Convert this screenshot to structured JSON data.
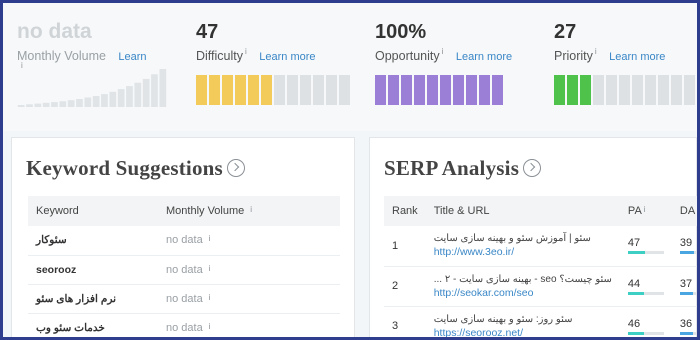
{
  "metrics": {
    "monthly_volume": {
      "value": "no data",
      "label": "Monthly Volume",
      "learn": "Learn",
      "info": "i"
    },
    "difficulty": {
      "value": "47",
      "label": "Difficulty",
      "learn": "Learn more",
      "info": "i",
      "color": "#f2cb5b",
      "filled": 6,
      "total": 12
    },
    "opportunity": {
      "value": "100%",
      "label": "Opportunity",
      "learn": "Learn more",
      "info": "i",
      "color": "#9b7fd6",
      "filled": 10,
      "total": 10
    },
    "priority": {
      "value": "27",
      "label": "Priority",
      "learn": "Learn more",
      "info": "i",
      "color": "#4ec24b",
      "filled": 3,
      "total": 11
    }
  },
  "volume_chart": {
    "levels": [
      0.05,
      0.07,
      0.09,
      0.11,
      0.13,
      0.15,
      0.18,
      0.21,
      0.25,
      0.29,
      0.34,
      0.4,
      0.47,
      0.55,
      0.64,
      0.74,
      0.86,
      1.0
    ]
  },
  "keyword_suggestions": {
    "title": "Keyword Suggestions",
    "headers": [
      "Keyword",
      "Monthly Volume"
    ],
    "header_info": "i",
    "rows": [
      {
        "keyword": "سئوکار",
        "volume": "no data",
        "info": "i"
      },
      {
        "keyword": "seorooz",
        "volume": "no data",
        "info": "i"
      },
      {
        "keyword": "نرم افزار های سئو",
        "volume": "no data",
        "info": "i"
      },
      {
        "keyword": "خدمات سئو وب",
        "volume": "no data",
        "info": "i"
      }
    ]
  },
  "serp_analysis": {
    "title": "SERP Analysis",
    "headers": [
      "Rank",
      "Title & URL",
      "PA",
      "DA"
    ],
    "header_info": "i",
    "rows": [
      {
        "rank": "1",
        "title": "سئو | آموزش سئو و بهینه سازی سایت",
        "url": "http://www.3eo.ir/",
        "pa": "47",
        "da": "39",
        "pa_pct": 0.47,
        "da_pct": 0.39
      },
      {
        "rank": "2",
        "title": "سئو چیست؟ seo - بهینه سازی سایت - ۲ ...",
        "url": "http://seokar.com/seo",
        "pa": "44",
        "da": "37",
        "pa_pct": 0.44,
        "da_pct": 0.37
      },
      {
        "rank": "3",
        "title": "سئو روز: سئو و بهینه سازی سایت",
        "url": "https://seorooz.net/",
        "pa": "46",
        "da": "36",
        "pa_pct": 0.46,
        "da_pct": 0.36
      }
    ],
    "pa_color": "#3ecfc4",
    "da_color": "#49a6e0"
  }
}
